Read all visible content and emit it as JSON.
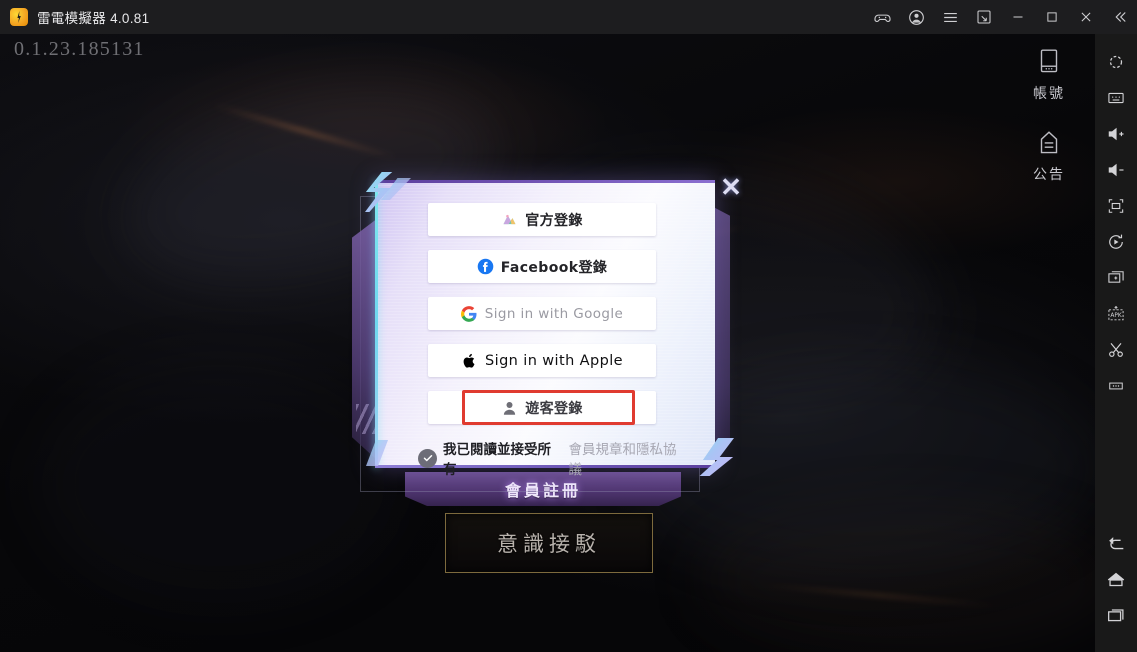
{
  "titlebar": {
    "app_name": "雷電模擬器",
    "version": "4.0.81",
    "logo_icon": "ldplayer-logo-icon",
    "buttons": [
      {
        "name": "gamepad-icon",
        "tooltip": "Keyboard mapping"
      },
      {
        "name": "account-icon",
        "tooltip": "Account"
      },
      {
        "name": "hamburger-menu-icon",
        "tooltip": "Menu"
      },
      {
        "name": "multi-instance-icon",
        "tooltip": "Multi instance"
      },
      {
        "name": "minimize-icon",
        "tooltip": "Minimize"
      },
      {
        "name": "maximize-icon",
        "tooltip": "Maximize"
      },
      {
        "name": "close-icon",
        "tooltip": "Close"
      },
      {
        "name": "collapse-icon",
        "tooltip": "Collapse sidebar"
      }
    ]
  },
  "game": {
    "version_overlay": "0.1.23.185131",
    "rail": [
      {
        "icon": "account-card-icon",
        "label": "帳號"
      },
      {
        "icon": "announcement-icon",
        "label": "公告"
      }
    ],
    "register_banner": "會員註冊",
    "start_button": "意識接駁"
  },
  "dialog": {
    "close_label": "✕",
    "close_icon": "dialog-close-icon",
    "buttons": [
      {
        "id": "official",
        "icon": "official-logo-icon",
        "label": "官方登錄"
      },
      {
        "id": "facebook",
        "icon": "facebook-icon",
        "label": "Facebook登錄"
      },
      {
        "id": "google",
        "icon": "google-g-icon",
        "label": "Sign in with Google"
      },
      {
        "id": "apple",
        "icon": "apple-logo-icon",
        "label": "Sign in with Apple"
      },
      {
        "id": "guest",
        "icon": "guest-person-icon",
        "label": "遊客登錄"
      }
    ],
    "agreement": {
      "checkbox_icon": "checkmark-circle-icon",
      "checked": true,
      "text_plain": "我已閱讀並接受所有",
      "text_link": "會員規章和隱私協議"
    },
    "highlight_target": "guest",
    "highlight_color": "#e03b30"
  },
  "toolbar": {
    "items": [
      {
        "icon": "settings-gear-icon",
        "tooltip": "Settings"
      },
      {
        "icon": "keyboard-icon",
        "tooltip": "Keyboard"
      },
      {
        "icon": "volume-up-icon",
        "tooltip": "Volume up"
      },
      {
        "icon": "volume-down-icon",
        "tooltip": "Volume down"
      },
      {
        "icon": "fullscreen-icon",
        "tooltip": "Full screen"
      },
      {
        "icon": "rotate-screen-icon",
        "tooltip": "Rotate"
      },
      {
        "icon": "add-window-icon",
        "tooltip": "New window"
      },
      {
        "icon": "apk-install-icon",
        "tooltip": "Install APK"
      },
      {
        "icon": "scissors-icon",
        "tooltip": "Screenshot"
      },
      {
        "icon": "more-options-icon",
        "tooltip": "More"
      }
    ],
    "nav": [
      {
        "icon": "android-back-icon",
        "tooltip": "Back"
      },
      {
        "icon": "android-home-icon",
        "tooltip": "Home"
      },
      {
        "icon": "android-recents-icon",
        "tooltip": "Recents"
      }
    ]
  },
  "colors": {
    "accent_cyan": "#7fe7ee",
    "accent_purple": "#6e4fb0",
    "highlight_red": "#e03b30",
    "titlebar_bg": "#1d1d1f",
    "toolbar_bg": "#191919"
  }
}
